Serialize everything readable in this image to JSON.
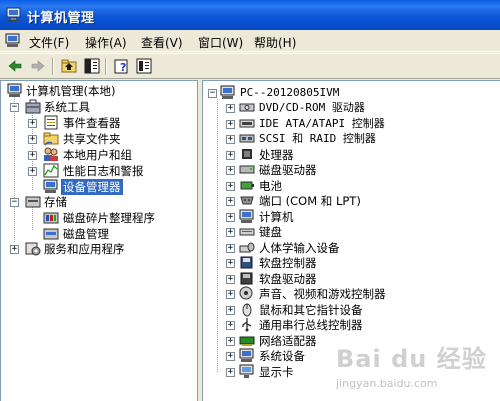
{
  "window": {
    "title": "计算机管理"
  },
  "menubar": {
    "items": [
      "文件(F)",
      "操作(A)",
      "查看(V)",
      "窗口(W)",
      "帮助(H)"
    ]
  },
  "toolbar": {
    "buttons": [
      "back-icon",
      "forward-icon",
      "up-icon",
      "show-hide-tree-icon",
      "help-icon",
      "properties-icon"
    ]
  },
  "left_tree": {
    "root": "计算机管理(本地)",
    "system_tools": "系统工具",
    "event_viewer": "事件查看器",
    "shared_folders": "共享文件夹",
    "local_users": "本地用户和组",
    "perf_logs": "性能日志和警报",
    "device_manager": "设备管理器",
    "storage": "存储",
    "defrag": "磁盘碎片整理程序",
    "disk_mgmt": "磁盘管理",
    "services_apps": "服务和应用程序"
  },
  "device_tree": {
    "computer": "PC--20120805IVM",
    "categories": [
      "DVD/CD-ROM 驱动器",
      "IDE ATA/ATAPI 控制器",
      "SCSI 和 RAID 控制器",
      "处理器",
      "磁盘驱动器",
      "电池",
      "端口 (COM 和 LPT)",
      "计算机",
      "键盘",
      "人体学输入设备",
      "软盘控制器",
      "软盘驱动器",
      "声音、视频和游戏控制器",
      "鼠标和其它指针设备",
      "通用串行总线控制器",
      "网络适配器",
      "系统设备",
      "显示卡"
    ]
  },
  "watermark": {
    "brand": "Bai du 经验",
    "url": "jingyan.baidu.com"
  },
  "colors": {
    "titlebar": "#0a5ee5",
    "selection": "#316ac5",
    "chrome": "#ece9d8"
  }
}
